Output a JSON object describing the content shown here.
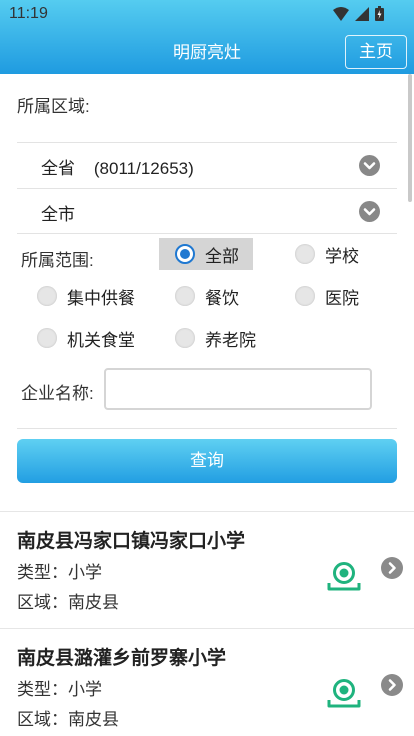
{
  "status_bar": {
    "time": "11:19"
  },
  "header": {
    "title": "明厨亮灶",
    "home_label": "主页"
  },
  "filter": {
    "region_label": "所属区域:",
    "province_value": "全省    (8011/12653)",
    "city_value": "全市",
    "scope_label": "所属范围:",
    "scope_options": [
      "全部",
      "学校",
      "集中供餐",
      "餐饮",
      "医院",
      "机关食堂",
      "养老院"
    ],
    "scope_selected": "全部",
    "company_label": "企业名称:",
    "company_value": "",
    "query_label": "查询"
  },
  "results": [
    {
      "name": "南皮县冯家口镇冯家口小学",
      "type_line": "类型：小学",
      "area_line": "区域：南皮县"
    },
    {
      "name": "南皮县潞灌乡前罗寨小学",
      "type_line": "类型：小学",
      "area_line": "区域：南皮县"
    }
  ],
  "colors": {
    "header_top": "#55ccf0",
    "header_bottom": "#1f9be0",
    "camera_green": "#1fb37e",
    "radio_selected": "#1f78d1"
  }
}
